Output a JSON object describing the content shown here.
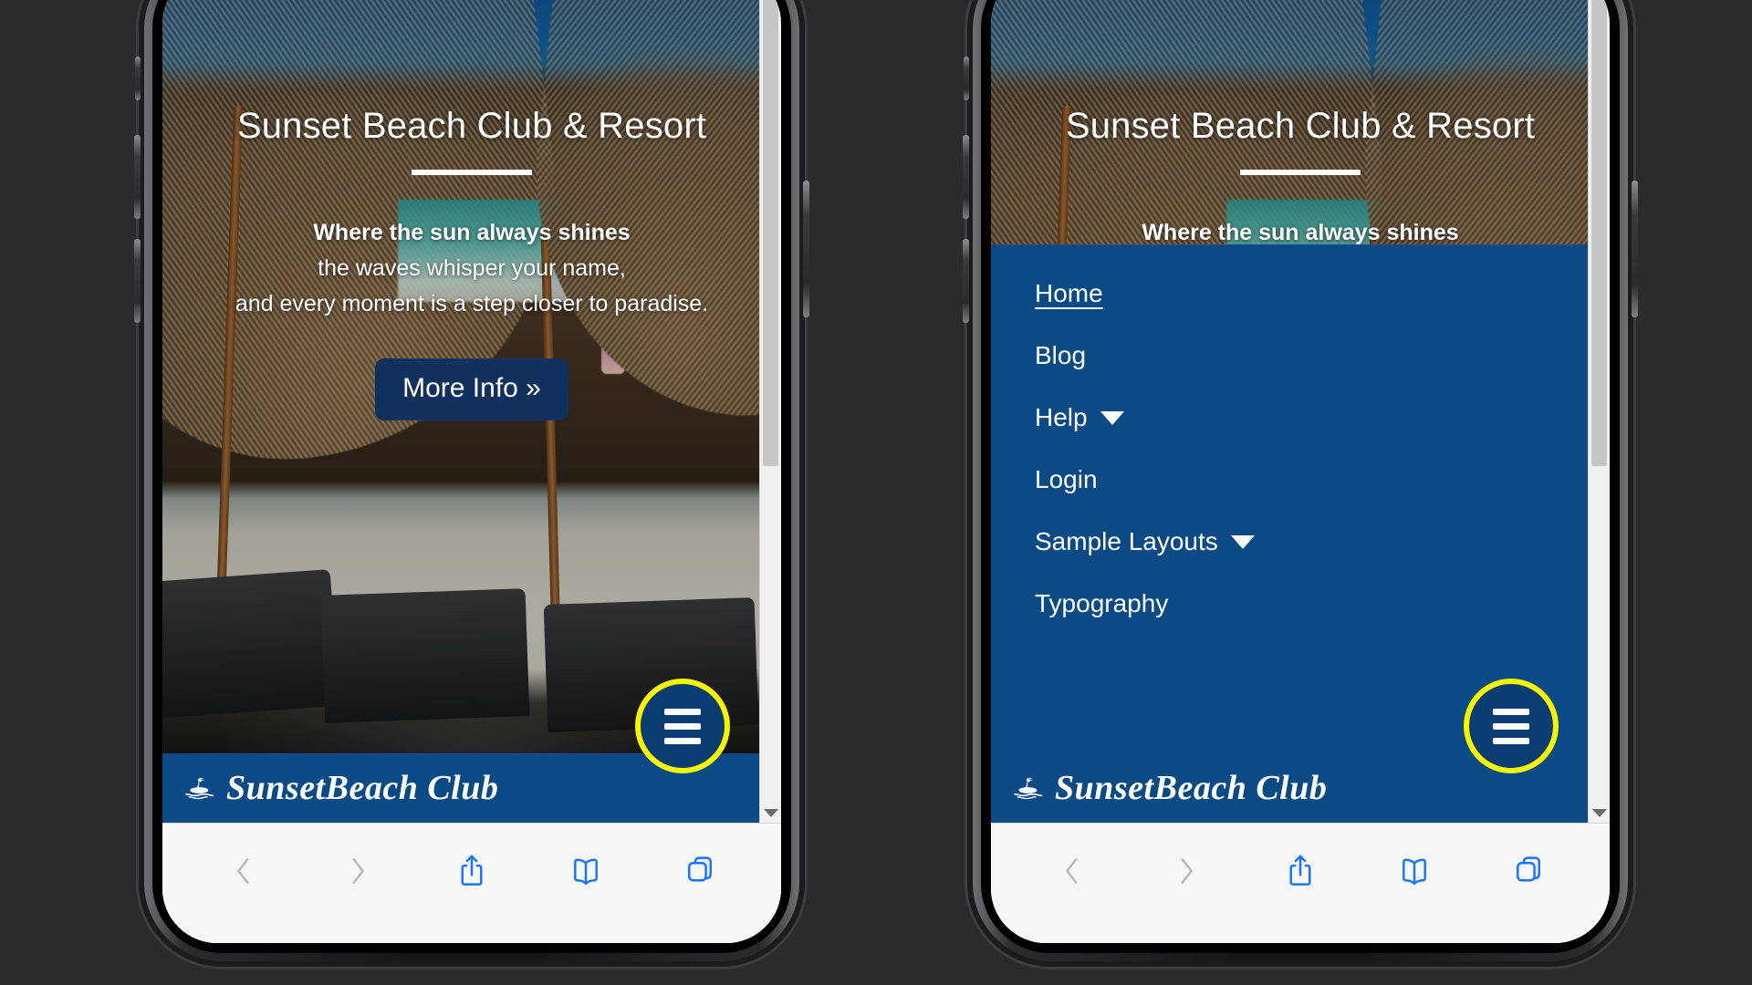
{
  "site": {
    "hero_title": "Sunset Beach Club & Resort",
    "hero_line1": "Where the sun always shines",
    "hero_line2": "the waves whisper your name,",
    "hero_line3": "and every moment is a step closer to paradise.",
    "cta_label": "More Info »",
    "logo_text": "SunsetBeach Club",
    "logo_icon": "palm-island-icon"
  },
  "nav": {
    "menu_button_icon": "hamburger-menu-icon",
    "items": [
      {
        "label": "Home",
        "active": true,
        "has_caret": false
      },
      {
        "label": "Blog",
        "active": false,
        "has_caret": false
      },
      {
        "label": "Help",
        "active": false,
        "has_caret": true
      },
      {
        "label": "Login",
        "active": false,
        "has_caret": false
      },
      {
        "label": "Sample Layouts",
        "active": false,
        "has_caret": true
      },
      {
        "label": "Typography",
        "active": false,
        "has_caret": false
      }
    ]
  },
  "browser_toolbar": {
    "items": [
      {
        "name": "back-button",
        "icon": "chevron-left-icon",
        "state": "disabled"
      },
      {
        "name": "forward-button",
        "icon": "chevron-right-icon",
        "state": "disabled"
      },
      {
        "name": "share-button",
        "icon": "share-icon",
        "state": "enabled"
      },
      {
        "name": "bookmarks-button",
        "icon": "book-icon",
        "state": "enabled"
      },
      {
        "name": "tabs-button",
        "icon": "tabs-icon",
        "state": "enabled"
      }
    ]
  },
  "colors": {
    "brand_blue": "#0b4a85",
    "cta_blue": "#12305e",
    "highlight_yellow": "#f5f500",
    "toolbar_blue": "#1a74ff",
    "toolbar_disabled": "#b9b9b9",
    "page_background": "#2b2b2b"
  },
  "phones": [
    {
      "id": "phone-left",
      "menu_open": false
    },
    {
      "id": "phone-right",
      "menu_open": true
    }
  ]
}
